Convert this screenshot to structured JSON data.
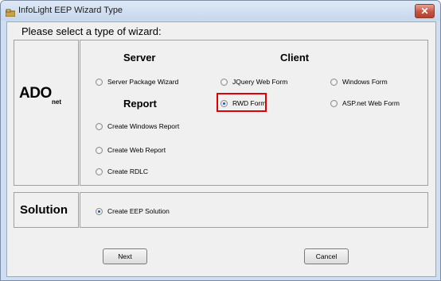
{
  "window": {
    "title": "InfoLight EEP Wizard Type",
    "close_glyph": "✕"
  },
  "prompt": "Please select a type of wizard:",
  "ado_logo": {
    "main": "ADO",
    "sub": "net"
  },
  "solution_label": "Solution",
  "sections": {
    "server": "Server",
    "client": "Client",
    "report": "Report"
  },
  "options": {
    "server_package_wizard": "Server Package Wizard",
    "jquery_web_form": "JQuery Web Form",
    "windows_form": "Windows Form",
    "rwd_form": "RWD Form",
    "aspnet_web_form": "ASP.net Web Form",
    "create_windows_report": "Create Windows Report",
    "create_web_report": "Create Web Report",
    "create_rdlc": "Create RDLC",
    "create_eep_solution": "Create EEP Solution"
  },
  "selected": [
    "rwd_form",
    "create_eep_solution"
  ],
  "buttons": {
    "next": "Next",
    "cancel": "Cancel"
  },
  "colors": {
    "highlight": "#e00000",
    "radio_selected": "#1a5bb8",
    "close_button": "#c65441"
  },
  "icons": {
    "app": "app-icon",
    "close": "close-icon"
  }
}
